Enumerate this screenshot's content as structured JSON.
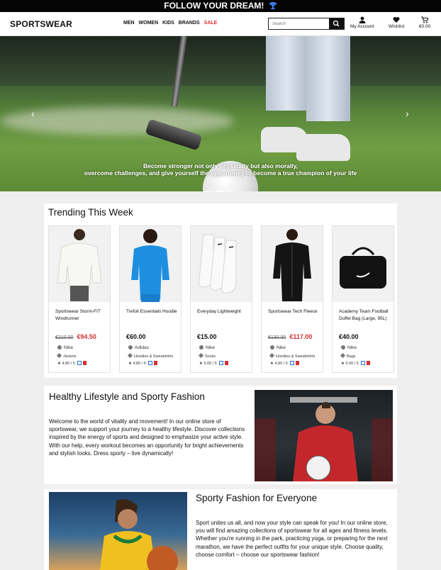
{
  "topbar": {
    "text": "FOLLOW YOUR DREAM!",
    "icon": "trophy-icon"
  },
  "header": {
    "logo": "SPORTSWEAR",
    "nav": [
      "MEN",
      "WOMEN",
      "KIDS",
      "BRANDS",
      "SALE"
    ],
    "search_placeholder": "Search",
    "account_label": "My Account",
    "wishlist_label": "Wishlist",
    "cart_label": "€0.00"
  },
  "hero": {
    "caption_line1": "Become stronger not only physically but also morally,",
    "caption_line2": "overcome challenges, and give yourself the opportunity to become a true champion of your life",
    "prev": "‹",
    "next": "›",
    "active_slide": 1,
    "slide_count": 3
  },
  "trending": {
    "title": "Trending This Week",
    "products": [
      {
        "name": "Sportswear Storm-FIT Windrunner",
        "old_price": "€210.00",
        "price": "€94.50",
        "brand": "Nike",
        "category": "Jackets",
        "rating": "4.80 / 5"
      },
      {
        "name": "Trefoil Essentials Hoodie",
        "old_price": "",
        "price": "€60.00",
        "brand": "Adidas",
        "category": "Hoodies & Sweatshirts",
        "rating": "4.80 / 5"
      },
      {
        "name": "Everyday Lightweight",
        "old_price": "",
        "price": "€15.00",
        "brand": "Nike",
        "category": "Socks",
        "rating": "5.00 / 5"
      },
      {
        "name": "Sportswear Tech Fleece",
        "old_price": "€130.00",
        "price": "€117.00",
        "brand": "Nike",
        "category": "Hoodies & Sweatshirts",
        "rating": "4.80 / 5"
      },
      {
        "name": "Academy Team Football Duffel Bag (Large, 95L)",
        "old_price": "",
        "price": "€40.00",
        "brand": "Nike",
        "category": "Bags",
        "rating": "5.00 / 5"
      }
    ]
  },
  "section1": {
    "title": "Healthy Lifestyle and Sporty Fashion",
    "text": "Welcome to the world of vitality and movement! In our online store of sportswear, we support your journey to a healthy lifestyle. Discover collections inspired by the energy of sports and designed to emphasize your active style. With our help, every workout becomes an opportunity for bright achievements and stylish looks. Dress sporty – live dynamically!"
  },
  "section2": {
    "title": "Sporty Fashion for Everyone",
    "text": "Sport unites us all, and now your style can speak for you! In our online store, you will find amazing collections of sportswear for all ages and fitness levels. Whether you're running in the park, practicing yoga, or preparing for the next marathon, we have the perfect outfits for your unique style. Choose quality, choose comfort – choose our sportswear fashion!"
  },
  "colors": {
    "accent": "#d63030",
    "topbar": "#050505",
    "link": "#2b6fd6"
  }
}
